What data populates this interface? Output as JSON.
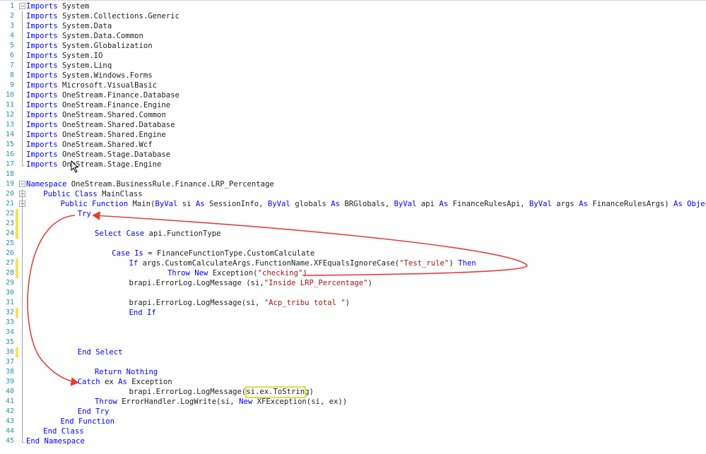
{
  "editor": {
    "lines": [
      {
        "n": "1",
        "indent": 0,
        "tokens": [
          {
            "t": "Imports",
            "c": "kw"
          },
          {
            "t": " System",
            "c": ""
          }
        ]
      },
      {
        "n": "2",
        "indent": 0,
        "tokens": [
          {
            "t": "Imports",
            "c": "kw"
          },
          {
            "t": " System.Collections.Generic",
            "c": ""
          }
        ]
      },
      {
        "n": "3",
        "indent": 0,
        "tokens": [
          {
            "t": "Imports",
            "c": "kw"
          },
          {
            "t": " System.Data",
            "c": ""
          }
        ]
      },
      {
        "n": "4",
        "indent": 0,
        "tokens": [
          {
            "t": "Imports",
            "c": "kw"
          },
          {
            "t": " System.Data.Common",
            "c": ""
          }
        ]
      },
      {
        "n": "5",
        "indent": 0,
        "tokens": [
          {
            "t": "Imports",
            "c": "kw"
          },
          {
            "t": " System.Globalization",
            "c": ""
          }
        ]
      },
      {
        "n": "6",
        "indent": 0,
        "tokens": [
          {
            "t": "Imports",
            "c": "kw"
          },
          {
            "t": " System.IO",
            "c": ""
          }
        ]
      },
      {
        "n": "7",
        "indent": 0,
        "tokens": [
          {
            "t": "Imports",
            "c": "kw"
          },
          {
            "t": " System.Linq",
            "c": ""
          }
        ]
      },
      {
        "n": "8",
        "indent": 0,
        "tokens": [
          {
            "t": "Imports",
            "c": "kw"
          },
          {
            "t": " System.Windows.Forms",
            "c": ""
          }
        ]
      },
      {
        "n": "9",
        "indent": 0,
        "tokens": [
          {
            "t": "Imports",
            "c": "kw"
          },
          {
            "t": " Microsoft.VisualBasic",
            "c": ""
          }
        ]
      },
      {
        "n": "10",
        "indent": 0,
        "tokens": [
          {
            "t": "Imports",
            "c": "kw"
          },
          {
            "t": " OneStream.Finance.Database",
            "c": ""
          }
        ]
      },
      {
        "n": "11",
        "indent": 0,
        "tokens": [
          {
            "t": "Imports",
            "c": "kw"
          },
          {
            "t": " OneStream.Finance.Engine",
            "c": ""
          }
        ]
      },
      {
        "n": "12",
        "indent": 0,
        "tokens": [
          {
            "t": "Imports",
            "c": "kw"
          },
          {
            "t": " OneStream.Shared.Common",
            "c": ""
          }
        ]
      },
      {
        "n": "13",
        "indent": 0,
        "tokens": [
          {
            "t": "Imports",
            "c": "kw"
          },
          {
            "t": " OneStream.Shared.Database",
            "c": ""
          }
        ]
      },
      {
        "n": "14",
        "indent": 0,
        "tokens": [
          {
            "t": "Imports",
            "c": "kw"
          },
          {
            "t": " OneStream.Shared.Engine",
            "c": ""
          }
        ]
      },
      {
        "n": "15",
        "indent": 0,
        "tokens": [
          {
            "t": "Imports",
            "c": "kw"
          },
          {
            "t": " OneStream.Shared.Wcf",
            "c": ""
          }
        ]
      },
      {
        "n": "16",
        "indent": 0,
        "tokens": [
          {
            "t": "Imports",
            "c": "kw"
          },
          {
            "t": " OneStream.Stage.Database",
            "c": ""
          }
        ]
      },
      {
        "n": "17",
        "indent": 0,
        "tokens": [
          {
            "t": "Imports",
            "c": "kw"
          },
          {
            "t": " OneStream.Stage.Engine",
            "c": ""
          }
        ]
      },
      {
        "n": "18",
        "indent": 0,
        "tokens": []
      },
      {
        "n": "19",
        "indent": 0,
        "tokens": [
          {
            "t": "Namespace",
            "c": "kw"
          },
          {
            "t": " OneStream.BusinessRule.Finance.LRP_Percentage",
            "c": ""
          }
        ]
      },
      {
        "n": "20",
        "indent": 4,
        "tokens": [
          {
            "t": "Public",
            "c": "kw"
          },
          {
            "t": " ",
            "c": ""
          },
          {
            "t": "Class",
            "c": "kw"
          },
          {
            "t": " MainClass",
            "c": ""
          }
        ]
      },
      {
        "n": "21",
        "indent": 8,
        "tokens": [
          {
            "t": "Public",
            "c": "kw"
          },
          {
            "t": " ",
            "c": ""
          },
          {
            "t": "Function",
            "c": "kw"
          },
          {
            "t": " Main(",
            "c": ""
          },
          {
            "t": "ByVal",
            "c": "kw"
          },
          {
            "t": " si ",
            "c": ""
          },
          {
            "t": "As",
            "c": "kw"
          },
          {
            "t": " SessionInfo, ",
            "c": ""
          },
          {
            "t": "ByVal",
            "c": "kw"
          },
          {
            "t": " globals ",
            "c": ""
          },
          {
            "t": "As",
            "c": "kw"
          },
          {
            "t": " BRGlobals, ",
            "c": ""
          },
          {
            "t": "ByVal",
            "c": "kw"
          },
          {
            "t": " api ",
            "c": ""
          },
          {
            "t": "As",
            "c": "kw"
          },
          {
            "t": " FinanceRulesApi, ",
            "c": ""
          },
          {
            "t": "ByVal",
            "c": "kw"
          },
          {
            "t": " args ",
            "c": ""
          },
          {
            "t": "As",
            "c": "kw"
          },
          {
            "t": " FinanceRulesArgs) ",
            "c": ""
          },
          {
            "t": "As",
            "c": "kw"
          },
          {
            "t": " ",
            "c": ""
          },
          {
            "t": "Object",
            "c": "kw"
          }
        ]
      },
      {
        "n": "22",
        "indent": 12,
        "tokens": [
          {
            "t": "Try",
            "c": "kw"
          }
        ]
      },
      {
        "n": "23",
        "indent": 0,
        "tokens": []
      },
      {
        "n": "24",
        "indent": 16,
        "tokens": [
          {
            "t": "Select",
            "c": "kw"
          },
          {
            "t": " ",
            "c": ""
          },
          {
            "t": "Case",
            "c": "kw"
          },
          {
            "t": " api.FunctionType",
            "c": ""
          }
        ]
      },
      {
        "n": "25",
        "indent": 0,
        "tokens": []
      },
      {
        "n": "26",
        "indent": 20,
        "tokens": [
          {
            "t": "Case",
            "c": "kw"
          },
          {
            "t": " ",
            "c": ""
          },
          {
            "t": "Is",
            "c": "kw"
          },
          {
            "t": " = FinanceFunctionType.CustomCalculate",
            "c": ""
          }
        ]
      },
      {
        "n": "27",
        "indent": 24,
        "tokens": [
          {
            "t": "If",
            "c": "kw"
          },
          {
            "t": " args.CustomCalculateArgs.FunctionName.XFEqualsIgnoreCase(",
            "c": ""
          },
          {
            "t": "\"Test_rule\"",
            "c": "str"
          },
          {
            "t": ") ",
            "c": ""
          },
          {
            "t": "Then",
            "c": "kw"
          }
        ]
      },
      {
        "n": "28",
        "indent": 33,
        "tokens": [
          {
            "t": "Throw",
            "c": "kw"
          },
          {
            "t": " ",
            "c": ""
          },
          {
            "t": "New",
            "c": "kw"
          },
          {
            "t": " Exception(",
            "c": ""
          },
          {
            "t": "\"checking\"",
            "c": "str"
          },
          {
            "t": ")",
            "c": ""
          }
        ]
      },
      {
        "n": "29",
        "indent": 24,
        "tokens": [
          {
            "t": "brapi.ErrorLog.LogMessage (si,",
            "c": ""
          },
          {
            "t": "\"Inside LRP_Percentage\"",
            "c": "str"
          },
          {
            "t": ")",
            "c": ""
          }
        ]
      },
      {
        "n": "30",
        "indent": 0,
        "tokens": []
      },
      {
        "n": "31",
        "indent": 24,
        "tokens": [
          {
            "t": "brapi.ErrorLog.LogMessage(si, ",
            "c": ""
          },
          {
            "t": "\"Acp_tribu total \"",
            "c": "str"
          },
          {
            "t": ")",
            "c": ""
          }
        ]
      },
      {
        "n": "32",
        "indent": 24,
        "tokens": [
          {
            "t": "End",
            "c": "kw"
          },
          {
            "t": " ",
            "c": ""
          },
          {
            "t": "If",
            "c": "kw"
          }
        ]
      },
      {
        "n": "33",
        "indent": 0,
        "tokens": []
      },
      {
        "n": "34",
        "indent": 0,
        "tokens": []
      },
      {
        "n": "35",
        "indent": 0,
        "tokens": []
      },
      {
        "n": "36",
        "indent": 12,
        "tokens": [
          {
            "t": "End",
            "c": "kw"
          },
          {
            "t": " ",
            "c": ""
          },
          {
            "t": "Select",
            "c": "kw"
          }
        ]
      },
      {
        "n": "37",
        "indent": 0,
        "tokens": []
      },
      {
        "n": "38",
        "indent": 16,
        "tokens": [
          {
            "t": "Return",
            "c": "kw"
          },
          {
            "t": " ",
            "c": ""
          },
          {
            "t": "Nothing",
            "c": "kw"
          }
        ]
      },
      {
        "n": "39",
        "indent": 12,
        "tokens": [
          {
            "t": "Catch",
            "c": "kw"
          },
          {
            "t": " ex ",
            "c": ""
          },
          {
            "t": "As",
            "c": "kw"
          },
          {
            "t": " Exception",
            "c": ""
          }
        ]
      },
      {
        "n": "40",
        "indent": 24,
        "tokens": [
          {
            "t": "brapi.ErrorLog.LogMessage(si.ex.ToString)",
            "c": ""
          }
        ]
      },
      {
        "n": "41",
        "indent": 16,
        "tokens": [
          {
            "t": "Throw",
            "c": "kw"
          },
          {
            "t": " ErrorHandler.LogWrite(si, ",
            "c": ""
          },
          {
            "t": "New",
            "c": "kw"
          },
          {
            "t": " XFException(si, ex))",
            "c": ""
          }
        ]
      },
      {
        "n": "42",
        "indent": 12,
        "tokens": [
          {
            "t": "End",
            "c": "kw"
          },
          {
            "t": " ",
            "c": ""
          },
          {
            "t": "Try",
            "c": "kw"
          }
        ]
      },
      {
        "n": "43",
        "indent": 8,
        "tokens": [
          {
            "t": "End",
            "c": "kw"
          },
          {
            "t": " ",
            "c": ""
          },
          {
            "t": "Function",
            "c": "kw"
          }
        ]
      },
      {
        "n": "44",
        "indent": 4,
        "tokens": [
          {
            "t": "End",
            "c": "kw"
          },
          {
            "t": " ",
            "c": ""
          },
          {
            "t": "Class",
            "c": "kw"
          }
        ]
      },
      {
        "n": "45",
        "indent": 0,
        "tokens": [
          {
            "t": "End",
            "c": "kw"
          },
          {
            "t": " ",
            "c": ""
          },
          {
            "t": "Namespace",
            "c": "kw"
          }
        ]
      }
    ],
    "changed_lines": [
      "22",
      "23",
      "24",
      "27",
      "28",
      "32",
      "36"
    ],
    "fold_lines": [
      "1",
      "19",
      "20",
      "21"
    ],
    "fold_glyph": "−",
    "colors": {
      "keyword": "#0000ff",
      "string": "#a31515",
      "line_number": "#2b91af",
      "change_marker": "#f1e35a",
      "annotation_arrow": "#e0413b",
      "highlight_box": "#d7e04a"
    },
    "annotations": {
      "arrow_icon": "red-curved-arrow-icon",
      "highlight_icon": "yellow-rectangle-highlight",
      "cursor_icon": "mouse-pointer-icon"
    }
  }
}
